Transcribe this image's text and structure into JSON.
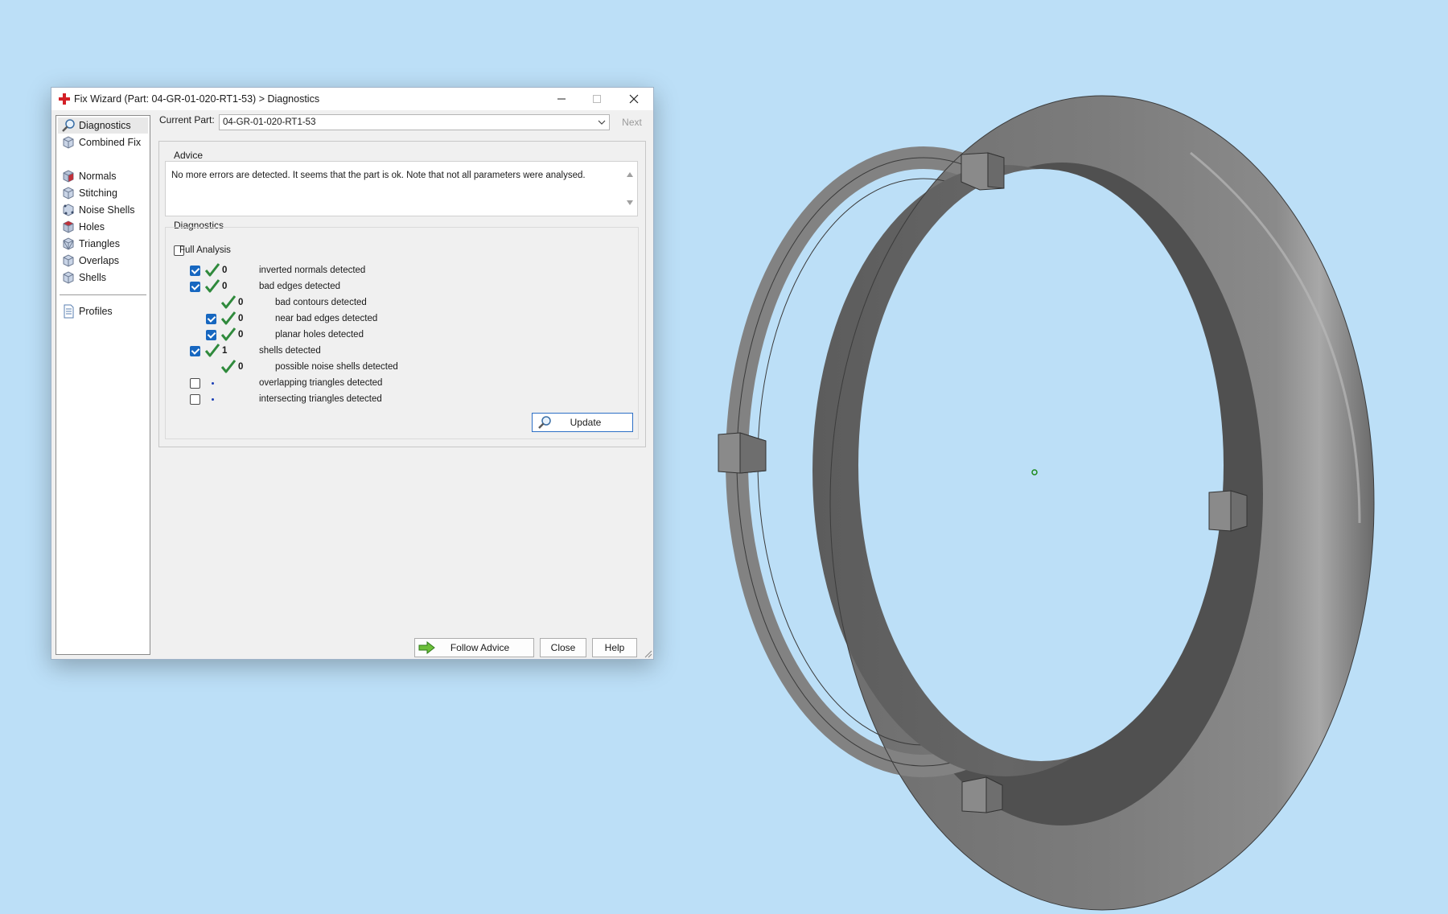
{
  "window": {
    "title": "Fix Wizard (Part: 04-GR-01-020-RT1-53) > Diagnostics",
    "app_icon": "red-cross-icon",
    "controls": [
      "minimize-icon",
      "maximize-icon",
      "close-icon"
    ]
  },
  "sidebar": {
    "items": [
      {
        "label": "Diagnostics",
        "icon": "magnifier-icon",
        "selected": true
      },
      {
        "label": "Combined Fix",
        "icon": "cube-icon"
      },
      {
        "label": "Normals",
        "icon": "red-cube-icon"
      },
      {
        "label": "Stitching",
        "icon": "cube-icon"
      },
      {
        "label": "Noise Shells",
        "icon": "cube-icon"
      },
      {
        "label": "Holes",
        "icon": "red-cube-icon"
      },
      {
        "label": "Triangles",
        "icon": "cube-icon"
      },
      {
        "label": "Overlaps",
        "icon": "cube-icon"
      },
      {
        "label": "Shells",
        "icon": "cube-icon"
      },
      {
        "label": "Profiles",
        "icon": "document-icon"
      }
    ]
  },
  "current_part": {
    "label": "Current Part:",
    "value": "04-GR-01-020-RT1-53",
    "next_label": "Next"
  },
  "advice": {
    "title": "Advice",
    "text": "No more errors are detected. It seems that the part is ok. Note that not all parameters were analysed."
  },
  "diagnostics": {
    "title": "Diagnostics",
    "full_analysis_label": "Full Analysis",
    "full_analysis_checked": false,
    "rows": [
      {
        "checkbox": true,
        "checked": true,
        "status": "ok",
        "value": "0",
        "label": "inverted normals detected"
      },
      {
        "checkbox": true,
        "checked": true,
        "status": "ok",
        "value": "0",
        "label": "bad edges detected"
      },
      {
        "checkbox": false,
        "checked": false,
        "status": "ok",
        "value": "0",
        "label": "bad contours detected"
      },
      {
        "checkbox": true,
        "checked": true,
        "status": "ok",
        "value": "0",
        "label": "near bad edges detected"
      },
      {
        "checkbox": true,
        "checked": true,
        "status": "ok",
        "value": "0",
        "label": "planar holes detected"
      },
      {
        "checkbox": true,
        "checked": true,
        "status": "ok",
        "value": "1",
        "label": "shells detected"
      },
      {
        "checkbox": false,
        "checked": false,
        "status": "ok",
        "value": "0",
        "label": "possible noise shells detected"
      },
      {
        "checkbox": true,
        "checked": false,
        "status": "pending",
        "value": "",
        "label": "overlapping triangles detected"
      },
      {
        "checkbox": true,
        "checked": false,
        "status": "pending",
        "value": "",
        "label": "intersecting triangles detected"
      }
    ],
    "update_label": "Update"
  },
  "buttons": {
    "follow_advice": "Follow Advice",
    "close": "Close",
    "help": "Help"
  },
  "colors": {
    "viewport_background": "#bcdff7",
    "check_green": "#2f8a3c",
    "checkbox_blue": "#1767c0",
    "model_gray": "#7a7a7a"
  }
}
